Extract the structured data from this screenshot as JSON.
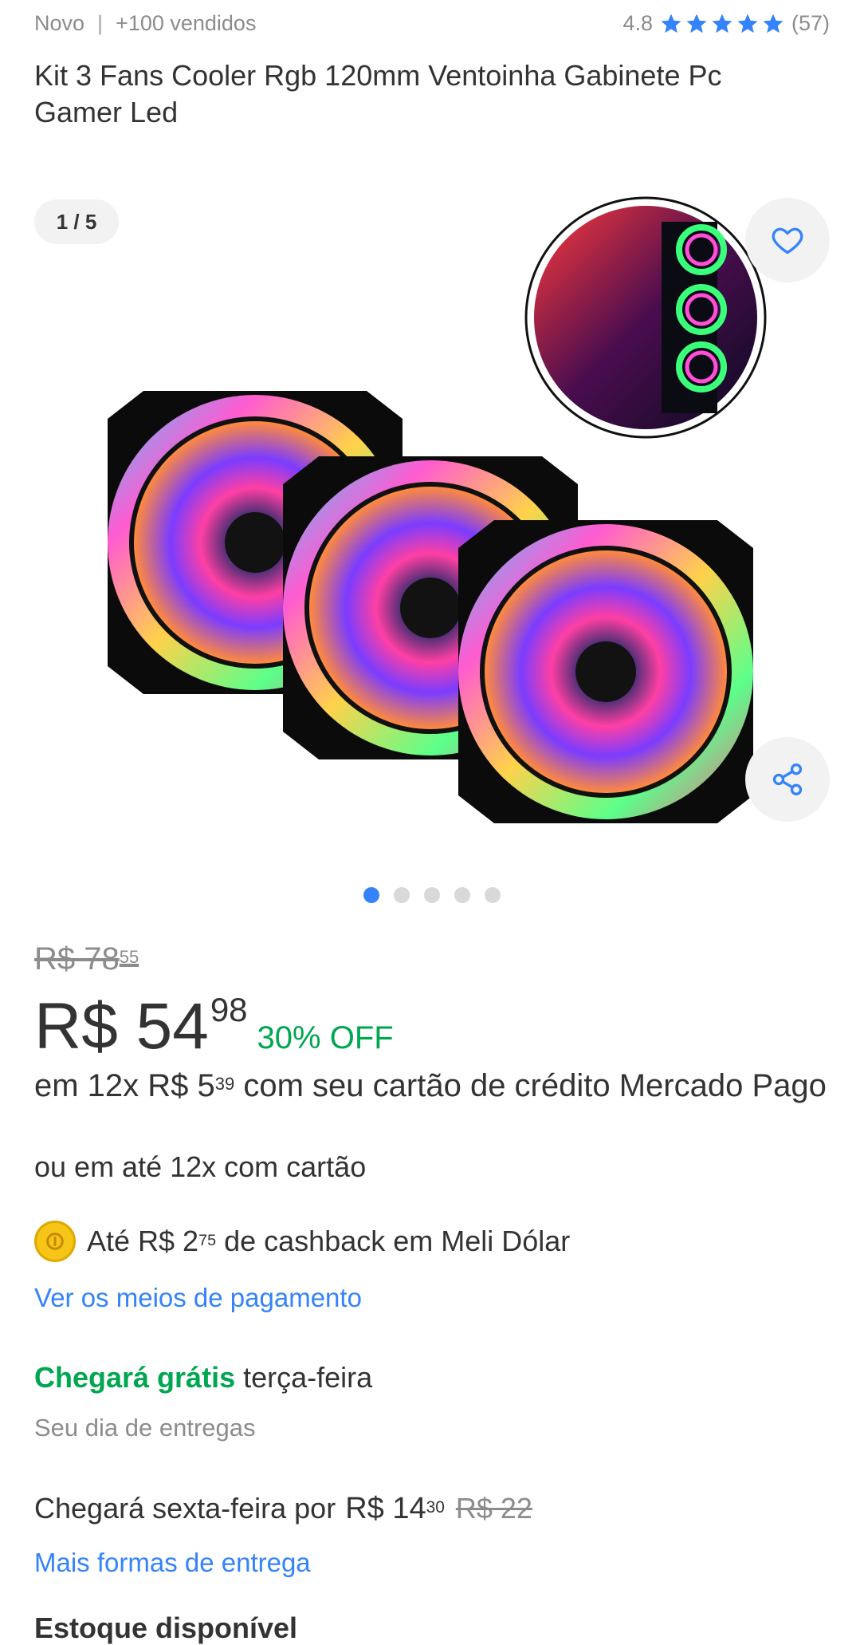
{
  "header": {
    "condition": "Novo",
    "separator": "|",
    "sold": "+100 vendidos",
    "rating_value": "4.8",
    "stars": 5,
    "rating_count": "(57)"
  },
  "product": {
    "title": "Kit 3 Fans Cooler Rgb 120mm Ventoinha Gabinete Pc Gamer Led"
  },
  "gallery": {
    "counter": "1 / 5",
    "total_images": 5,
    "active_index": 0,
    "favorite_icon": "heart-icon",
    "share_icon": "share-icon"
  },
  "pricing": {
    "old_price_main": "R$ 78",
    "old_price_cents": "55",
    "price_main": "R$ 54",
    "price_cents": "98",
    "discount": "30% OFF",
    "installment_prefix": "em 12x R$ 5",
    "installment_cents": "39",
    "installment_suffix": " com seu cartão de crédito Mercado Pago",
    "installment_alt": "ou em até 12x com cartão",
    "cashback_prefix": "Até R$ 2",
    "cashback_cents": "75",
    "cashback_suffix": " de cashback em Meli Dólar",
    "payment_link": "Ver os meios de pagamento"
  },
  "shipping": {
    "free_label": "Chegará grátis",
    "free_day": " terça-feira",
    "free_sub": "Seu dia de entregas",
    "paid_label": "Chegará sexta-feira por",
    "paid_price": "R$ 14",
    "paid_cents": "30",
    "paid_old": "R$ 22",
    "more_link": "Mais formas de entrega"
  },
  "stock": {
    "label": "Estoque disponível"
  },
  "colors": {
    "accent": "#3483fa",
    "green": "#00a650",
    "text": "#333333",
    "muted": "#8c8c8c"
  }
}
